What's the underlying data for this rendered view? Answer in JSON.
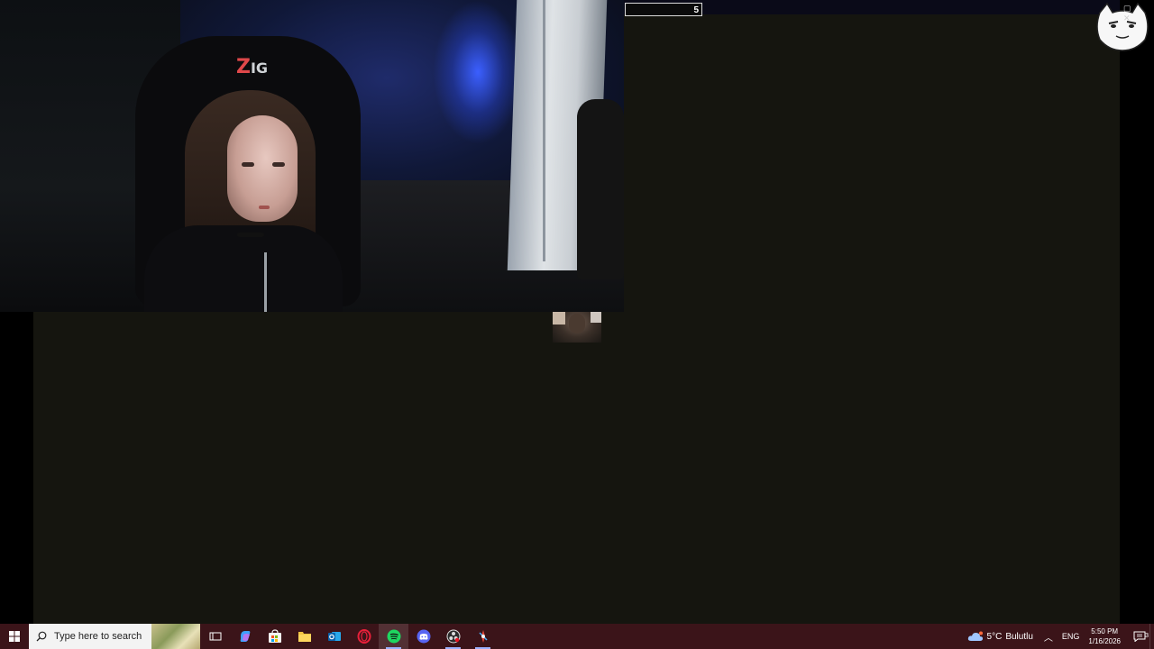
{
  "overlay": {
    "counter_value": "5"
  },
  "taskbar": {
    "search_placeholder": "Type here to search",
    "pinned_apps": [
      {
        "name": "task-view",
        "icon": "task-view-icon"
      },
      {
        "name": "copilot",
        "icon": "copilot-icon"
      },
      {
        "name": "microsoft-store",
        "icon": "store-icon"
      },
      {
        "name": "file-explorer",
        "icon": "folder-icon"
      },
      {
        "name": "outlook",
        "icon": "outlook-icon"
      },
      {
        "name": "opera-gx",
        "icon": "opera-icon"
      },
      {
        "name": "spotify",
        "icon": "spotify-icon"
      },
      {
        "name": "discord",
        "icon": "discord-icon"
      },
      {
        "name": "obs",
        "icon": "obs-icon"
      },
      {
        "name": "app",
        "icon": "app-icon"
      }
    ],
    "weather": {
      "temp": "5°C",
      "condition": "Bulutlu"
    },
    "language": "ENG",
    "time": "5:50 PM",
    "date": "1/16/2026",
    "notification_count": "3"
  },
  "colors": {
    "taskbar_bg": "#3b1419",
    "canvas_bg": "#15150f",
    "accent": "#9ab0ff"
  }
}
